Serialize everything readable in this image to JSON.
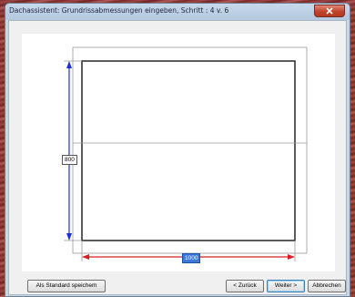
{
  "window": {
    "title": "Dachassistent: Grundrissabmessungen eingeben, Schritt : 4 v. 6"
  },
  "drawing": {
    "height_value": "800",
    "width_value": "1000"
  },
  "footer": {
    "save_default_label": "Als Standard speichem",
    "back_label": "< Zurück",
    "next_label": "Weiter >",
    "cancel_label": "Abbrechen"
  },
  "colors": {
    "height_dimension": "#1a2fd6",
    "width_dimension": "#d42020",
    "close_button": "#c0432c"
  }
}
